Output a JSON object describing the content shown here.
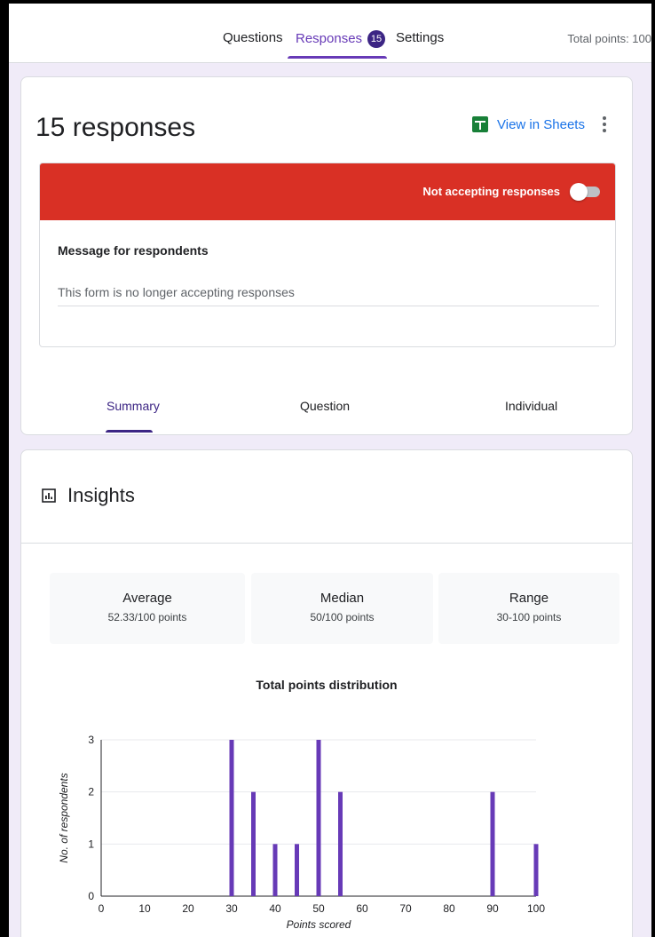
{
  "header": {
    "tabs": {
      "questions": "Questions",
      "responses": "Responses",
      "responses_badge": "15",
      "settings": "Settings"
    },
    "total_points": "Total points: 100"
  },
  "responses_card": {
    "title": "15 responses",
    "view_in_sheets": "View in Sheets",
    "banner_text": "Not accepting responses",
    "accepting_toggle_on": false,
    "message_label": "Message for respondents",
    "message_value": "This form is no longer accepting responses",
    "subtabs": {
      "summary": "Summary",
      "question": "Question",
      "individual": "Individual"
    }
  },
  "insights": {
    "title": "Insights",
    "stats": {
      "average_label": "Average",
      "average_value": "52.33/100 points",
      "median_label": "Median",
      "median_value": "50/100 points",
      "range_label": "Range",
      "range_value": "30-100 points"
    }
  },
  "colors": {
    "accent": "#673ab7",
    "bar": "#673ab7",
    "banner": "#d93025",
    "sheets_green": "#188038",
    "link_blue": "#1a73e8"
  },
  "chart_data": {
    "type": "bar",
    "title": "Total points distribution",
    "xlabel": "Points scored",
    "ylabel": "No. of respondents",
    "xlim": [
      0,
      100
    ],
    "ylim": [
      0,
      3
    ],
    "xticks": [
      0,
      10,
      20,
      30,
      40,
      50,
      60,
      70,
      80,
      90,
      100
    ],
    "yticks": [
      0,
      1,
      2,
      3
    ],
    "grid": true,
    "x": [
      30,
      35,
      40,
      45,
      50,
      55,
      90,
      100
    ],
    "values": [
      3,
      2,
      1,
      1,
      3,
      2,
      2,
      1
    ]
  }
}
